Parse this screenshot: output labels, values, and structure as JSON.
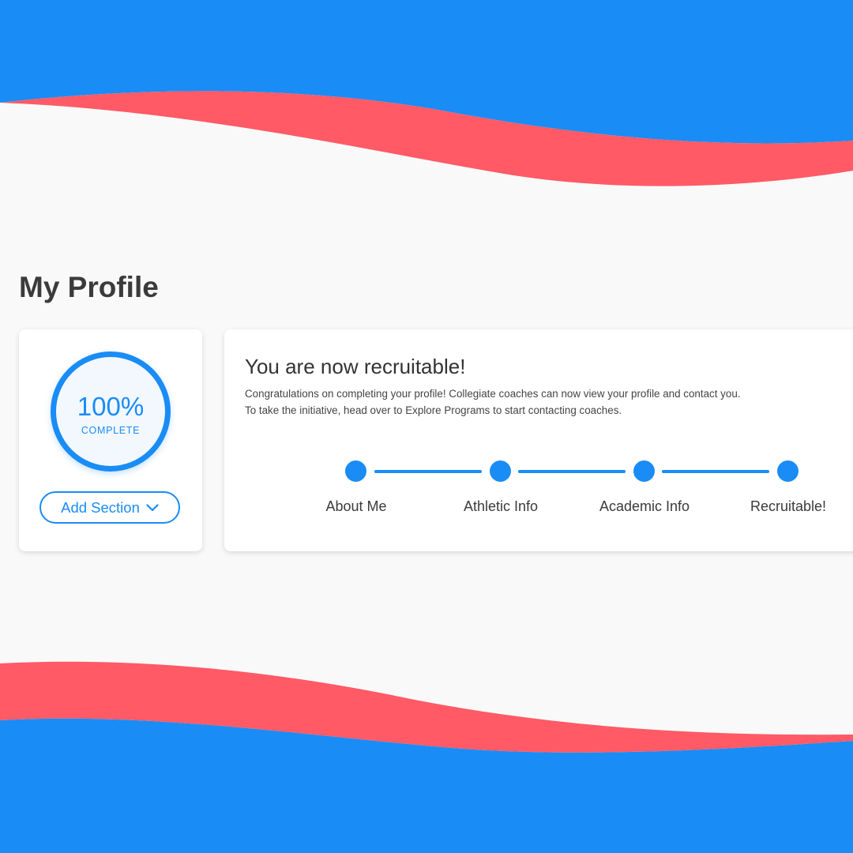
{
  "colors": {
    "blue": "#1a8cf5",
    "coral": "#ff5a66",
    "background": "#f9f9f9"
  },
  "page": {
    "title": "My Profile"
  },
  "progress": {
    "value": "100%",
    "label": "COMPLETE",
    "fraction": 1.0,
    "add_section_label": "Add Section",
    "add_section_icon": "chevron-down-icon"
  },
  "status": {
    "title": "You are now recruitable!",
    "description": "Congratulations on completing your profile! Collegiate coaches can now view your profile and contact you. To take the initiative, head over to Explore Programs to start contacting coaches."
  },
  "steps": [
    {
      "label": "About Me",
      "completed": true
    },
    {
      "label": "Athletic Info",
      "completed": true
    },
    {
      "label": "Academic Info",
      "completed": true
    },
    {
      "label": "Recruitable!",
      "completed": true
    }
  ]
}
